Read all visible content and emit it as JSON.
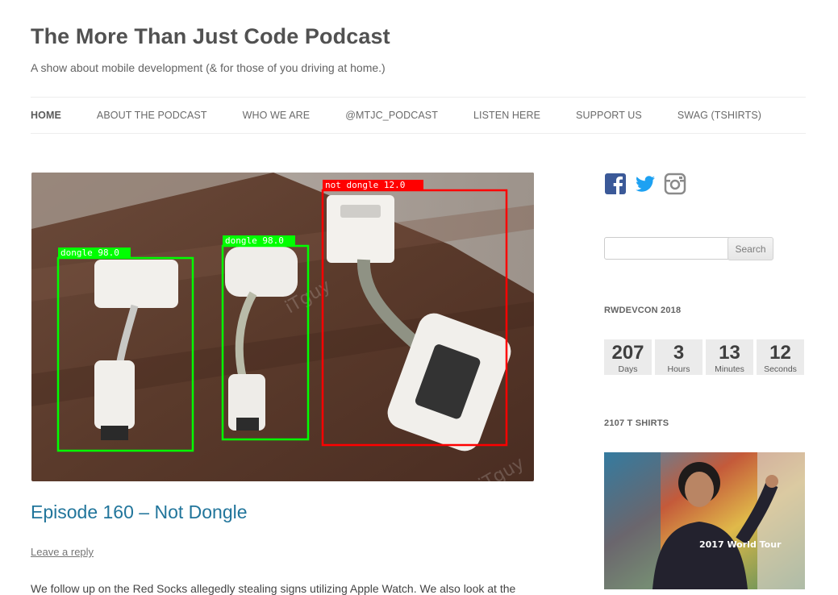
{
  "site": {
    "title": "The More Than Just Code Podcast",
    "tagline": "A show about mobile development (& for those of you driving at home.)"
  },
  "nav": {
    "items": [
      {
        "label": "HOME",
        "active": true
      },
      {
        "label": "ABOUT THE PODCAST",
        "active": false
      },
      {
        "label": "WHO WE ARE",
        "active": false
      },
      {
        "label": "@MTJC_PODCAST",
        "active": false
      },
      {
        "label": "LISTEN HERE",
        "active": false
      },
      {
        "label": "SUPPORT US",
        "active": false
      },
      {
        "label": "SWAG (TSHIRTS)",
        "active": false
      }
    ]
  },
  "post": {
    "image": {
      "detections": [
        {
          "label": "dongle 98.0",
          "color": "#00ff00"
        },
        {
          "label": "dongle 98.0",
          "color": "#00ff00"
        },
        {
          "label": "not dongle 12.0",
          "color": "#ff0000"
        }
      ],
      "watermark": "iTguy"
    },
    "title": "Episode 160 – Not Dongle",
    "reply_link": "Leave a reply",
    "excerpt": "We follow up on the Red Socks allegedly stealing signs utilizing Apple Watch. We also look at the"
  },
  "sidebar": {
    "social_icons": [
      "facebook-icon",
      "twitter-icon",
      "instagram-icon"
    ],
    "search": {
      "placeholder": "",
      "button_label": "Search"
    },
    "countdown": {
      "title": "RWDEVCON 2018",
      "units": [
        {
          "value": "207",
          "label": "Days"
        },
        {
          "value": "3",
          "label": "Hours"
        },
        {
          "value": "13",
          "label": "Minutes"
        },
        {
          "value": "12",
          "label": "Seconds"
        }
      ]
    },
    "tshirts": {
      "title": "2107 T SHIRTS",
      "shirt_text": "2017 World Tour"
    }
  },
  "colors": {
    "link": "#21759b",
    "facebook": "#3b5998",
    "twitter": "#1da1f2",
    "instagram": "#8a8a8a"
  }
}
